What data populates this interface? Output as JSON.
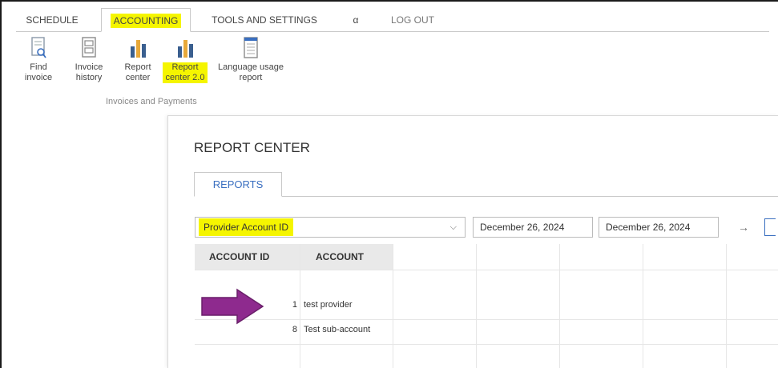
{
  "menu": {
    "tabs": [
      {
        "label": "SCHEDULE"
      },
      {
        "label": "ACCOUNTING"
      },
      {
        "label": "TOOLS AND SETTINGS"
      },
      {
        "label": "α"
      },
      {
        "label": "LOG OUT"
      }
    ]
  },
  "ribbon": {
    "items": [
      {
        "label": "Find invoice",
        "icon": "find-invoice-icon"
      },
      {
        "label": "Invoice history",
        "icon": "invoice-history-icon"
      },
      {
        "label": "Report center",
        "icon": "bar-chart-icon"
      },
      {
        "label": "Report center 2.0",
        "icon": "bar-chart-icon"
      },
      {
        "label": "Language usage report",
        "icon": "report-document-icon"
      }
    ],
    "group_label": "Invoices and Payments"
  },
  "report": {
    "title": "REPORT CENTER",
    "tab_label": "REPORTS",
    "selected_report": "Provider Account ID",
    "start_date": "December 26, 2024",
    "end_date": "December 26, 2024",
    "go_symbol": "→"
  },
  "table": {
    "columns": [
      "ACCOUNT ID",
      "ACCOUNT"
    ],
    "rows": [
      {
        "account_id": "1",
        "account": "test provider"
      },
      {
        "account_id": "8",
        "account": "Test sub-account"
      }
    ]
  },
  "colors": {
    "highlight": "#f5f500",
    "arrow": "#8e2a8e",
    "tab_text": "#3a6fc0"
  }
}
